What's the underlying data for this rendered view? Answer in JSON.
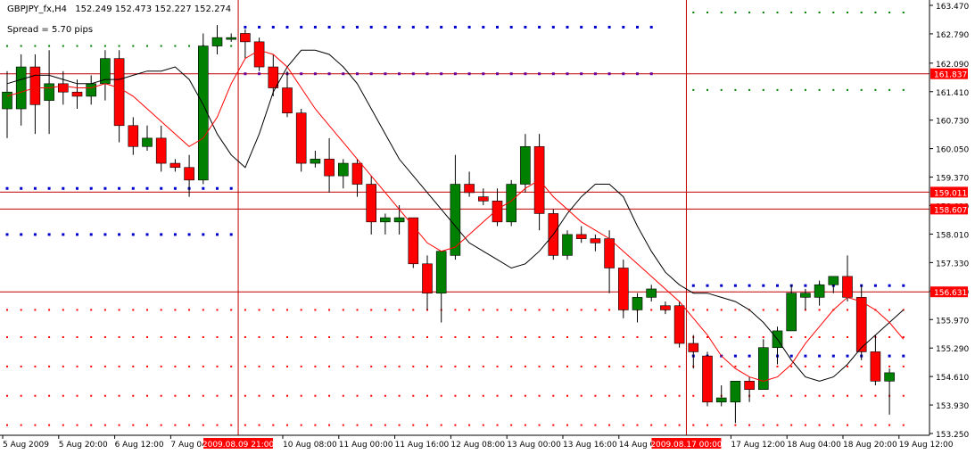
{
  "header": {
    "symbol": "GBPJPY_fx,H4",
    "ohlc": "152.249 152.473 152.227 152.274",
    "spread": "Spread = 5.70 pips"
  },
  "colors": {
    "bull": "#008000",
    "bear": "#ff0000",
    "ma_fast": "#ff0000",
    "ma_slow": "#000000",
    "level_line": "#c00000",
    "blue_dots": "#0000cc",
    "green_dots": "#008000",
    "red_dots": "#ff0000",
    "label_bg": "#ff0000",
    "label_text": "#ffffff"
  },
  "chart_data": {
    "type": "candlestick",
    "ylim": [
      153.25,
      163.47
    ],
    "y_ticks": [
      "163.470",
      "162.790",
      "162.090",
      "161.410",
      "160.730",
      "160.050",
      "159.370",
      "158.690",
      "158.010",
      "157.330",
      "156.650",
      "155.970",
      "155.290",
      "154.610",
      "153.930",
      "153.250"
    ],
    "x_ticks": [
      {
        "i": 0,
        "label": "5 Aug 2009"
      },
      {
        "i": 4,
        "label": "5 Aug 20:00"
      },
      {
        "i": 8,
        "label": "6 Aug 12:00"
      },
      {
        "i": 12,
        "label": "7 Aug 04:00"
      },
      {
        "i": 20,
        "label": "10 Aug 08:00"
      },
      {
        "i": 24,
        "label": "11 Aug 00:00"
      },
      {
        "i": 28,
        "label": "11 Aug 16:00"
      },
      {
        "i": 32,
        "label": "12 Aug 08:00"
      },
      {
        "i": 36,
        "label": "13 Aug 00:00"
      },
      {
        "i": 40,
        "label": "13 Aug 16:00"
      },
      {
        "i": 44,
        "label": "14 Aug 08:00"
      },
      {
        "i": 52,
        "label": "17 Aug 12:00"
      },
      {
        "i": 56,
        "label": "18 Aug 04:00"
      },
      {
        "i": 60,
        "label": "18 Aug 20:00"
      },
      {
        "i": 64,
        "label": "19 Aug 12:00"
      }
    ],
    "x_highlights": [
      {
        "i": 16.5,
        "label": "2009.08.09 21:00"
      },
      {
        "i": 48.5,
        "label": "2009.08.17 00:00"
      }
    ],
    "candles": [
      {
        "o": 161.0,
        "h": 161.9,
        "l": 160.3,
        "c": 161.4
      },
      {
        "o": 161.0,
        "h": 162.3,
        "l": 160.6,
        "c": 162.0
      },
      {
        "o": 162.0,
        "h": 162.3,
        "l": 160.4,
        "c": 161.1
      },
      {
        "o": 161.2,
        "h": 162.4,
        "l": 160.4,
        "c": 161.6
      },
      {
        "o": 161.6,
        "h": 161.9,
        "l": 161.1,
        "c": 161.4
      },
      {
        "o": 161.4,
        "h": 161.7,
        "l": 161.0,
        "c": 161.3
      },
      {
        "o": 161.3,
        "h": 161.8,
        "l": 161.1,
        "c": 161.6
      },
      {
        "o": 161.6,
        "h": 162.4,
        "l": 161.2,
        "c": 162.2
      },
      {
        "o": 162.2,
        "h": 162.4,
        "l": 160.2,
        "c": 160.6
      },
      {
        "o": 160.6,
        "h": 160.8,
        "l": 159.9,
        "c": 160.1
      },
      {
        "o": 160.1,
        "h": 160.6,
        "l": 160.0,
        "c": 160.3
      },
      {
        "o": 160.3,
        "h": 160.6,
        "l": 159.5,
        "c": 159.7
      },
      {
        "o": 159.7,
        "h": 159.8,
        "l": 159.5,
        "c": 159.6
      },
      {
        "o": 159.6,
        "h": 159.9,
        "l": 158.9,
        "c": 159.3
      },
      {
        "o": 159.3,
        "h": 162.8,
        "l": 159.2,
        "c": 162.5
      },
      {
        "o": 162.5,
        "h": 163.0,
        "l": 162.3,
        "c": 162.7
      },
      {
        "o": 162.7,
        "h": 162.8,
        "l": 162.6,
        "c": 162.7
      },
      {
        "o": 162.8,
        "h": 162.9,
        "l": 162.2,
        "c": 162.6
      },
      {
        "o": 162.6,
        "h": 162.7,
        "l": 161.9,
        "c": 162.0
      },
      {
        "o": 162.0,
        "h": 162.3,
        "l": 161.3,
        "c": 161.5
      },
      {
        "o": 161.5,
        "h": 161.9,
        "l": 160.8,
        "c": 160.9
      },
      {
        "o": 160.9,
        "h": 161.0,
        "l": 159.5,
        "c": 159.7
      },
      {
        "o": 159.7,
        "h": 160.0,
        "l": 159.6,
        "c": 159.8
      },
      {
        "o": 159.8,
        "h": 160.3,
        "l": 159.0,
        "c": 159.4
      },
      {
        "o": 159.4,
        "h": 159.8,
        "l": 159.1,
        "c": 159.7
      },
      {
        "o": 159.7,
        "h": 159.8,
        "l": 158.9,
        "c": 159.2
      },
      {
        "o": 159.2,
        "h": 159.4,
        "l": 158.0,
        "c": 158.3
      },
      {
        "o": 158.3,
        "h": 158.5,
        "l": 158.0,
        "c": 158.4
      },
      {
        "o": 158.3,
        "h": 158.7,
        "l": 158.0,
        "c": 158.4
      },
      {
        "o": 158.4,
        "h": 158.4,
        "l": 157.2,
        "c": 157.3
      },
      {
        "o": 157.3,
        "h": 157.5,
        "l": 156.2,
        "c": 156.6
      },
      {
        "o": 156.6,
        "h": 157.6,
        "l": 155.9,
        "c": 157.6
      },
      {
        "o": 157.5,
        "h": 159.9,
        "l": 157.4,
        "c": 159.2
      },
      {
        "o": 159.2,
        "h": 159.5,
        "l": 158.9,
        "c": 159.0
      },
      {
        "o": 158.9,
        "h": 159.1,
        "l": 158.7,
        "c": 158.8
      },
      {
        "o": 158.8,
        "h": 159.1,
        "l": 158.2,
        "c": 158.3
      },
      {
        "o": 158.3,
        "h": 159.3,
        "l": 158.2,
        "c": 159.2
      },
      {
        "o": 159.2,
        "h": 160.4,
        "l": 159.0,
        "c": 160.1
      },
      {
        "o": 160.1,
        "h": 160.4,
        "l": 158.1,
        "c": 158.5
      },
      {
        "o": 158.5,
        "h": 158.6,
        "l": 157.4,
        "c": 157.5
      },
      {
        "o": 157.5,
        "h": 158.1,
        "l": 157.4,
        "c": 158.0
      },
      {
        "o": 158.0,
        "h": 158.2,
        "l": 157.8,
        "c": 157.9
      },
      {
        "o": 157.9,
        "h": 158.0,
        "l": 157.6,
        "c": 157.8
      },
      {
        "o": 157.9,
        "h": 158.1,
        "l": 156.6,
        "c": 157.2
      },
      {
        "o": 157.2,
        "h": 157.4,
        "l": 156.0,
        "c": 156.2
      },
      {
        "o": 156.2,
        "h": 156.6,
        "l": 155.9,
        "c": 156.5
      },
      {
        "o": 156.5,
        "h": 156.8,
        "l": 156.4,
        "c": 156.7
      },
      {
        "o": 156.3,
        "h": 156.4,
        "l": 156.1,
        "c": 156.2
      },
      {
        "o": 156.3,
        "h": 156.4,
        "l": 155.3,
        "c": 155.4
      },
      {
        "o": 155.4,
        "h": 155.6,
        "l": 154.8,
        "c": 155.2
      },
      {
        "o": 155.1,
        "h": 155.2,
        "l": 153.9,
        "c": 154.0
      },
      {
        "o": 154.0,
        "h": 154.4,
        "l": 153.9,
        "c": 154.1
      },
      {
        "o": 154.0,
        "h": 154.5,
        "l": 153.5,
        "c": 154.5
      },
      {
        "o": 154.5,
        "h": 154.6,
        "l": 154.0,
        "c": 154.3
      },
      {
        "o": 154.3,
        "h": 155.5,
        "l": 154.3,
        "c": 155.3
      },
      {
        "o": 155.3,
        "h": 155.8,
        "l": 154.9,
        "c": 155.7
      },
      {
        "o": 155.7,
        "h": 156.8,
        "l": 155.7,
        "c": 156.6
      },
      {
        "o": 156.5,
        "h": 156.7,
        "l": 156.2,
        "c": 156.6
      },
      {
        "o": 156.5,
        "h": 156.9,
        "l": 156.3,
        "c": 156.8
      },
      {
        "o": 156.8,
        "h": 157.0,
        "l": 156.6,
        "c": 157.0
      },
      {
        "o": 157.0,
        "h": 157.5,
        "l": 156.4,
        "c": 156.5
      },
      {
        "o": 156.5,
        "h": 156.8,
        "l": 155.0,
        "c": 155.2
      },
      {
        "o": 155.2,
        "h": 155.6,
        "l": 154.4,
        "c": 154.5
      },
      {
        "o": 154.5,
        "h": 154.8,
        "l": 153.7,
        "c": 154.7
      }
    ],
    "ma_fast": [
      161.3,
      161.4,
      161.5,
      161.5,
      161.55,
      161.5,
      161.5,
      161.6,
      161.5,
      161.3,
      161.0,
      160.7,
      160.4,
      160.1,
      160.3,
      160.8,
      161.6,
      162.2,
      162.4,
      162.3,
      162.0,
      161.5,
      161.0,
      160.6,
      160.2,
      159.8,
      159.4,
      159.0,
      158.6,
      158.2,
      157.8,
      157.6,
      157.7,
      158.0,
      158.3,
      158.6,
      158.8,
      159.1,
      159.3,
      158.9,
      158.6,
      158.3,
      158.1,
      157.9,
      157.6,
      157.3,
      157.0,
      156.7,
      156.4,
      156.0,
      155.6,
      155.1,
      154.8,
      154.6,
      154.5,
      154.6,
      154.9,
      155.4,
      155.8,
      156.2,
      156.5,
      156.4,
      156.2,
      155.9,
      155.5
    ],
    "ma_slow": [
      161.6,
      161.7,
      161.8,
      161.8,
      161.7,
      161.6,
      161.6,
      161.7,
      161.7,
      161.8,
      161.9,
      161.9,
      162.0,
      161.7,
      161.1,
      160.4,
      159.9,
      159.6,
      160.4,
      161.4,
      162.0,
      162.4,
      162.4,
      162.3,
      162.0,
      161.6,
      161.0,
      160.4,
      159.8,
      159.4,
      159.0,
      158.6,
      158.2,
      157.8,
      157.6,
      157.4,
      157.2,
      157.3,
      157.6,
      158.0,
      158.5,
      158.9,
      159.2,
      159.2,
      158.9,
      158.2,
      157.6,
      157.1,
      156.8,
      156.6,
      156.6,
      156.5,
      156.4,
      156.2,
      155.9,
      155.5,
      155.0,
      154.6,
      154.5,
      154.6,
      154.9,
      155.3,
      155.6,
      155.9,
      156.2
    ],
    "levels": [
      {
        "y": 161.837,
        "label": "161.837"
      },
      {
        "y": 159.011,
        "label": "159.011"
      },
      {
        "y": 158.607,
        "label": "158.607"
      },
      {
        "y": 156.631,
        "label": "156.631"
      }
    ],
    "vlines": [
      16.5,
      48.5
    ],
    "dot_rows": [
      {
        "color": "blue",
        "y": 162.95,
        "from": 17,
        "to": 46
      },
      {
        "color": "purple",
        "y": 161.837,
        "from": 17,
        "to": 46
      },
      {
        "color": "blue",
        "y": 159.1,
        "from": 0,
        "to": 16
      },
      {
        "color": "blue",
        "y": 158.0,
        "from": 0,
        "to": 16
      },
      {
        "color": "blue",
        "y": 156.78,
        "from": 49,
        "to": 64
      },
      {
        "color": "blue",
        "y": 155.1,
        "from": 49,
        "to": 64
      },
      {
        "color": "green",
        "y": 162.5,
        "from": 0,
        "to": 16
      },
      {
        "color": "green",
        "y": 163.3,
        "from": 49,
        "to": 64
      },
      {
        "color": "green",
        "y": 161.45,
        "from": 49,
        "to": 64
      },
      {
        "color": "red",
        "y": 156.2,
        "from": 0,
        "to": 64
      },
      {
        "color": "red",
        "y": 155.55,
        "from": 0,
        "to": 64
      },
      {
        "color": "red",
        "y": 154.85,
        "from": 0,
        "to": 64
      },
      {
        "color": "red",
        "y": 154.15,
        "from": 0,
        "to": 64
      },
      {
        "color": "red",
        "y": 153.45,
        "from": 0,
        "to": 64
      }
    ]
  }
}
